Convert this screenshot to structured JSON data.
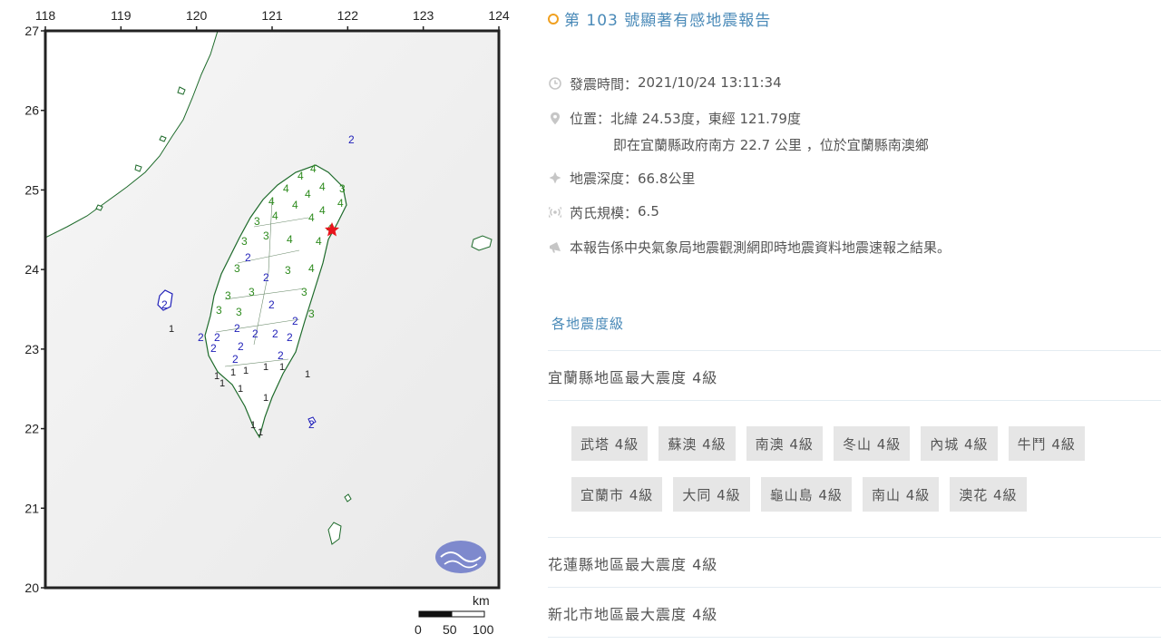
{
  "map": {
    "lon_labels": [
      "118",
      "119",
      "120",
      "121",
      "122",
      "123",
      "124"
    ],
    "lat_labels": [
      "27",
      "26",
      "25",
      "24",
      "23",
      "22",
      "21",
      "20"
    ],
    "scale": {
      "unit": "km",
      "ticks": [
        "0",
        "50",
        "100"
      ]
    },
    "intensity_colors": {
      "4": "#2e8b1e",
      "3": "#2e8b1e",
      "2": "#1f1fb8",
      "1": "#222222"
    },
    "epicenter_color": "#e8141c"
  },
  "report": {
    "title": "第 103 號顯著有感地震報告",
    "time_label": "發震時間：",
    "time_value": "2021/10/24 13:11:34",
    "location_label": "位置：",
    "location_value": "北緯 24.53度，東經 121.79度",
    "location_detail": "即在宜蘭縣政府南方 22.7 公里 ，位於宜蘭縣南澳鄉",
    "depth_label": "地震深度：",
    "depth_value": "66.8公里",
    "magnitude_label": "芮氏規模：",
    "magnitude_value": "6.5",
    "note": "本報告係中央氣象局地震觀測網即時地震資料地震速報之結果。"
  },
  "intensity_section": {
    "heading": "各地震度級",
    "regions": [
      {
        "name": "宜蘭縣地區最大震度 4級",
        "stations": [
          "武塔 4級",
          "蘇澳 4級",
          "南澳 4級",
          "冬山 4級",
          "內城 4級",
          "牛鬥 4級",
          "宜蘭市 4級",
          "大同 4級",
          "龜山島 4級",
          "南山 4級",
          "澳花 4級"
        ]
      },
      {
        "name": "花蓮縣地區最大震度 4級"
      },
      {
        "name": "新北市地區最大震度 4級"
      }
    ]
  }
}
